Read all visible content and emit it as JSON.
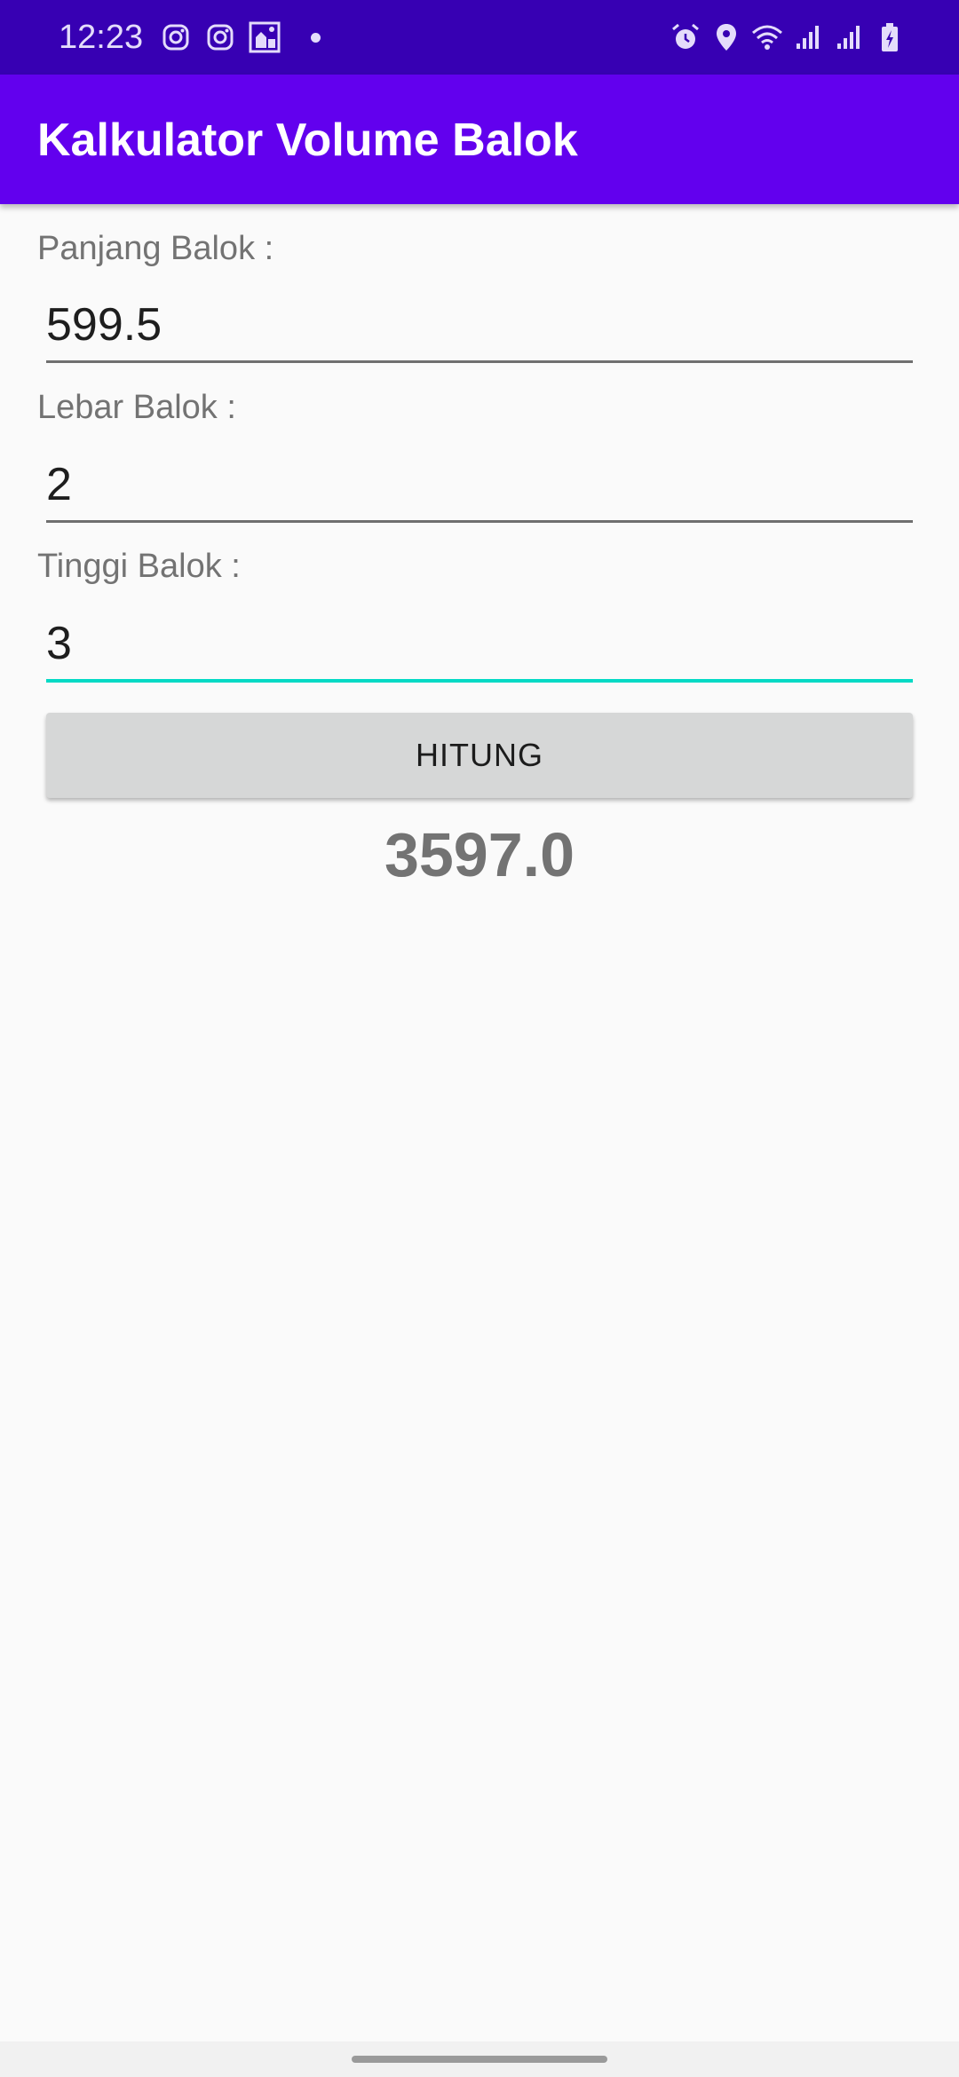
{
  "status_bar": {
    "time": "12:23",
    "left_icons": [
      "instagram-icon",
      "instagram-icon",
      "app-notification-icon"
    ],
    "right_icons": [
      "alarm-icon",
      "location-icon",
      "wifi-icon",
      "signal-icon",
      "signal-icon",
      "battery-charging-icon"
    ],
    "background": "#3700b3"
  },
  "app_bar": {
    "title": "Kalkulator Volume Balok",
    "background": "#6200ee"
  },
  "form": {
    "panjang_label": "Panjang Balok :",
    "panjang_value": "599.5",
    "lebar_label": "Lebar Balok :",
    "lebar_value": "2",
    "tinggi_label": "Tinggi Balok :",
    "tinggi_value": "3",
    "focused_accent": "#03dac5"
  },
  "button": {
    "label": "HITUNG"
  },
  "result": {
    "value": "3597.0"
  }
}
